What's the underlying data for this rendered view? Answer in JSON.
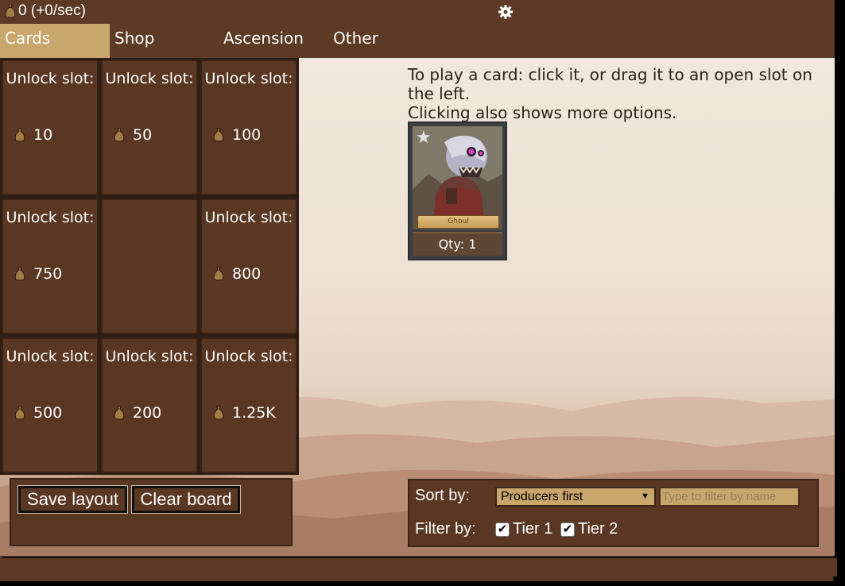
{
  "header": {
    "gold": "0 (+0/sec)",
    "settings_icon": "gear-icon"
  },
  "tabs": [
    {
      "label": "Cards",
      "active": true
    },
    {
      "label": "Shop",
      "active": false
    },
    {
      "label": "Ascension",
      "active": false
    },
    {
      "label": "Other",
      "active": false
    }
  ],
  "board": {
    "slots": [
      {
        "label": "Unlock slot:",
        "cost": "10"
      },
      {
        "label": "Unlock slot:",
        "cost": "50"
      },
      {
        "label": "Unlock slot:",
        "cost": "100"
      },
      {
        "label": "Unlock slot:",
        "cost": "750"
      },
      {
        "label": "",
        "cost": ""
      },
      {
        "label": "Unlock slot:",
        "cost": "800"
      },
      {
        "label": "Unlock slot:",
        "cost": "500"
      },
      {
        "label": "Unlock slot:",
        "cost": "200"
      },
      {
        "label": "Unlock slot:",
        "cost": "1.25K"
      }
    ]
  },
  "buttons": {
    "save": "Save layout",
    "clear": "Clear board"
  },
  "instructions": {
    "line1": "To play a card: click it, or drag it to an open slot on the left.",
    "line2": "Clicking also shows more options."
  },
  "card": {
    "name": "Ghoul",
    "qty": "Qty: 1",
    "star_icon": "star-icon"
  },
  "sort": {
    "label": "Sort by:",
    "selected": "Producers first",
    "filter_placeholder": "Type to filter by name"
  },
  "filter": {
    "label": "Filter by:",
    "tier1": "Tier 1",
    "tier2": "Tier 2",
    "tier1_checked": true,
    "tier2_checked": true
  },
  "colors": {
    "frame_brown": "#5d3a25",
    "slot_brown": "#5a3722",
    "active_tab": "#c8a66c"
  }
}
